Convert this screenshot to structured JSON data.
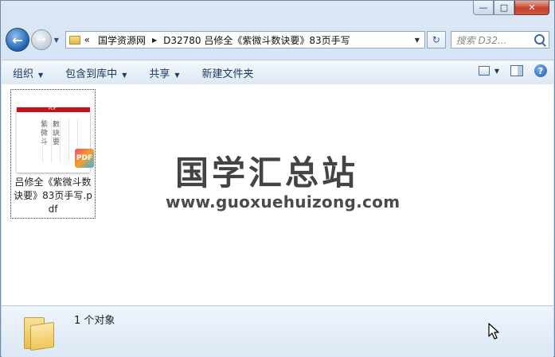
{
  "window": {
    "caption_buttons": [
      {
        "name": "minimize",
        "glyph": "—"
      },
      {
        "name": "maximize",
        "glyph": "□"
      },
      {
        "name": "close",
        "glyph": "✕"
      }
    ]
  },
  "nav": {
    "back_glyph": "←",
    "forward_glyph": "→",
    "recent_dropdown_glyph": "▼",
    "breadcrumb": {
      "overflow": "«",
      "items": [
        "国学资源网",
        "D32780 吕修全《紫微斗数诀要》83页手写"
      ],
      "separator": "▶"
    },
    "address_dropdown_glyph": "▼",
    "refresh_glyph": "↻",
    "search_placeholder": "搜索 D32..."
  },
  "toolbar": {
    "items": [
      {
        "label": "组织",
        "dropdown": "▼"
      },
      {
        "label": "包含到库中",
        "dropdown": "▼"
      },
      {
        "label": "共享",
        "dropdown": "▼"
      },
      {
        "label": "新建文件夹",
        "dropdown": ""
      }
    ],
    "view_dropdown": "▼",
    "help_glyph": "?"
  },
  "content": {
    "file": {
      "name": "吕修全《紫微斗数诀要》83页手写.pdf",
      "thumbnail_header": "PDF",
      "thumbnail_title_glyphs": [
        "紫",
        "微",
        "斗",
        "數",
        "訣",
        "要"
      ],
      "badge": "PDF"
    },
    "watermark": {
      "title": "国学汇总站",
      "url": "www.guoxuehuizong.com"
    }
  },
  "status": {
    "text": "1 个对象"
  },
  "colors": {
    "close_button": "#c4402a",
    "pdf_header_bar": "#c4121a",
    "toolbar_text": "#1c3a63"
  }
}
